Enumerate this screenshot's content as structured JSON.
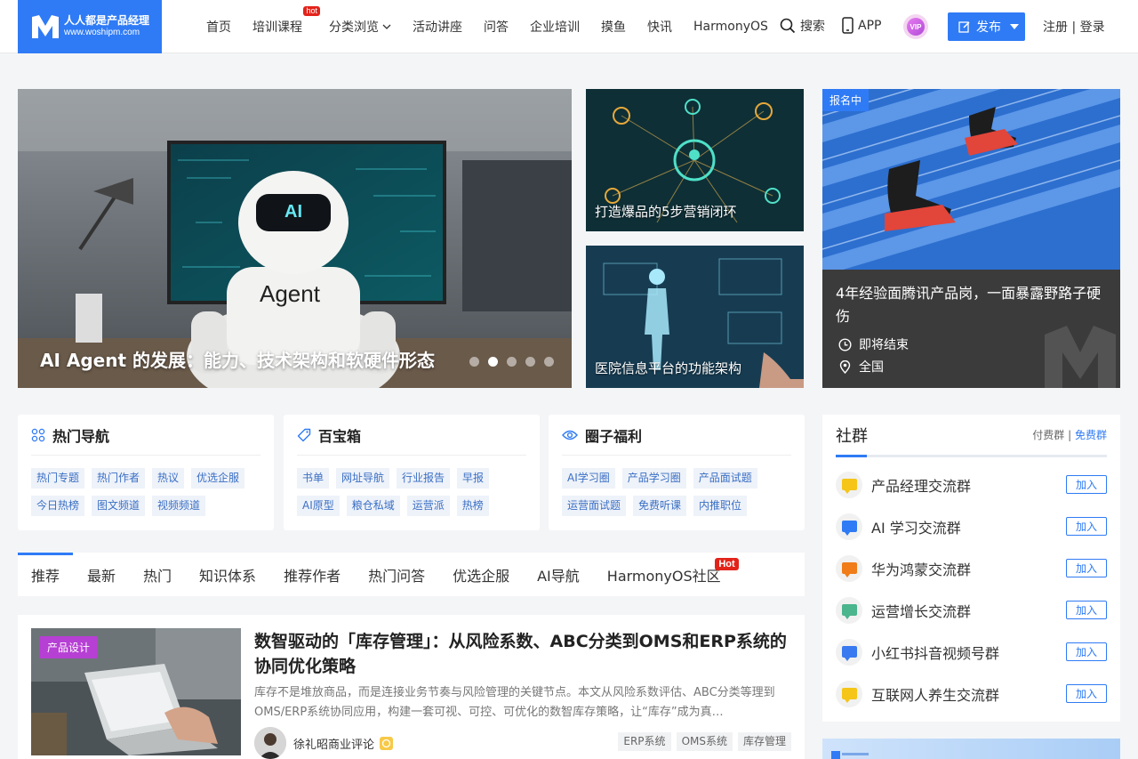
{
  "header": {
    "logo": {
      "name": "人人都是产品经理",
      "url": "www.woshipm.com"
    },
    "nav": [
      {
        "label": "首页"
      },
      {
        "label": "培训课程",
        "badge": "hot"
      },
      {
        "label": "分类浏览"
      },
      {
        "label": "活动讲座"
      },
      {
        "label": "问答"
      },
      {
        "label": "企业培训"
      },
      {
        "label": "摸鱼"
      },
      {
        "label": "快讯"
      },
      {
        "label": "HarmonyOS"
      }
    ],
    "search_label": "搜索",
    "app_label": "APP",
    "vip_label": "VIP",
    "publish_label": "发布",
    "login_label": "注册 | 登录"
  },
  "hero": {
    "main_title": "AI Agent 的发展：能力、技术架构和软硬件形态",
    "main_image_text": [
      "AI",
      "Agent"
    ],
    "slides": 5,
    "active_slide": 2,
    "card1": "打造爆品的5步营销闭环",
    "card2": "医院信息平台的功能架构",
    "event": {
      "badge": "报名中",
      "title": "4年经验面腾讯产品岗，一面暴露野路子硬伤",
      "status": "即将结束",
      "location": "全国"
    }
  },
  "boxes": [
    {
      "title": "热门导航",
      "icon": "grid-icon",
      "tags": [
        "热门专题",
        "热门作者",
        "热议",
        "优选企服",
        "今日热榜",
        "图文频道",
        "视频频道"
      ]
    },
    {
      "title": "百宝箱",
      "icon": "tag-icon",
      "tags": [
        "书单",
        "网址导航",
        "行业报告",
        "早报",
        "AI原型",
        "粮仓私域",
        "运营派",
        "热榜"
      ]
    },
    {
      "title": "圈子福利",
      "icon": "eye-icon",
      "tags": [
        "AI学习圈",
        "产品学习圈",
        "产品面试题",
        "运营面试题",
        "免费听课",
        "内推职位"
      ]
    }
  ],
  "community": {
    "title": "社群",
    "paid_label": "付费群",
    "free_label": "免费群",
    "join_label": "加入",
    "groups": [
      {
        "name": "产品经理交流群",
        "color": "#f5c518"
      },
      {
        "name": "AI 学习交流群",
        "color": "#2f7bf5"
      },
      {
        "name": "华为鸿蒙交流群",
        "color": "#f07d1a"
      },
      {
        "name": "运营增长交流群",
        "color": "#4bb58e"
      },
      {
        "name": "小红书抖音视频号群",
        "color": "#3a7af0"
      },
      {
        "name": "互联网人养生交流群",
        "color": "#f5c518"
      }
    ]
  },
  "tabs": [
    {
      "label": "推荐"
    },
    {
      "label": "最新"
    },
    {
      "label": "热门"
    },
    {
      "label": "知识体系"
    },
    {
      "label": "推荐作者"
    },
    {
      "label": "热门问答"
    },
    {
      "label": "优选企服"
    },
    {
      "label": "AI导航"
    },
    {
      "label": "HarmonyOS社区",
      "badge": "Hot"
    }
  ],
  "article": {
    "category": "产品设计",
    "title": "数智驱动的「库存管理」：从风险系数、ABC分类到OMS和ERP系统的协同优化策略",
    "summary": "库存不是堆放商品，而是连接业务节奏与风险管理的关键节点。本文从风险系数评估、ABC分类等理到OMS/ERP系统协同应用，构建一套可视、可控、可优化的数智库存策略，让“库存”成为真…",
    "author": "徐礼昭商业评论",
    "tags": [
      "ERP系统",
      "OMS系统",
      "库存管理"
    ]
  },
  "colors": {
    "brand": "#2f7bf5",
    "hot": "#e2231a",
    "category": "#b63fd4"
  }
}
